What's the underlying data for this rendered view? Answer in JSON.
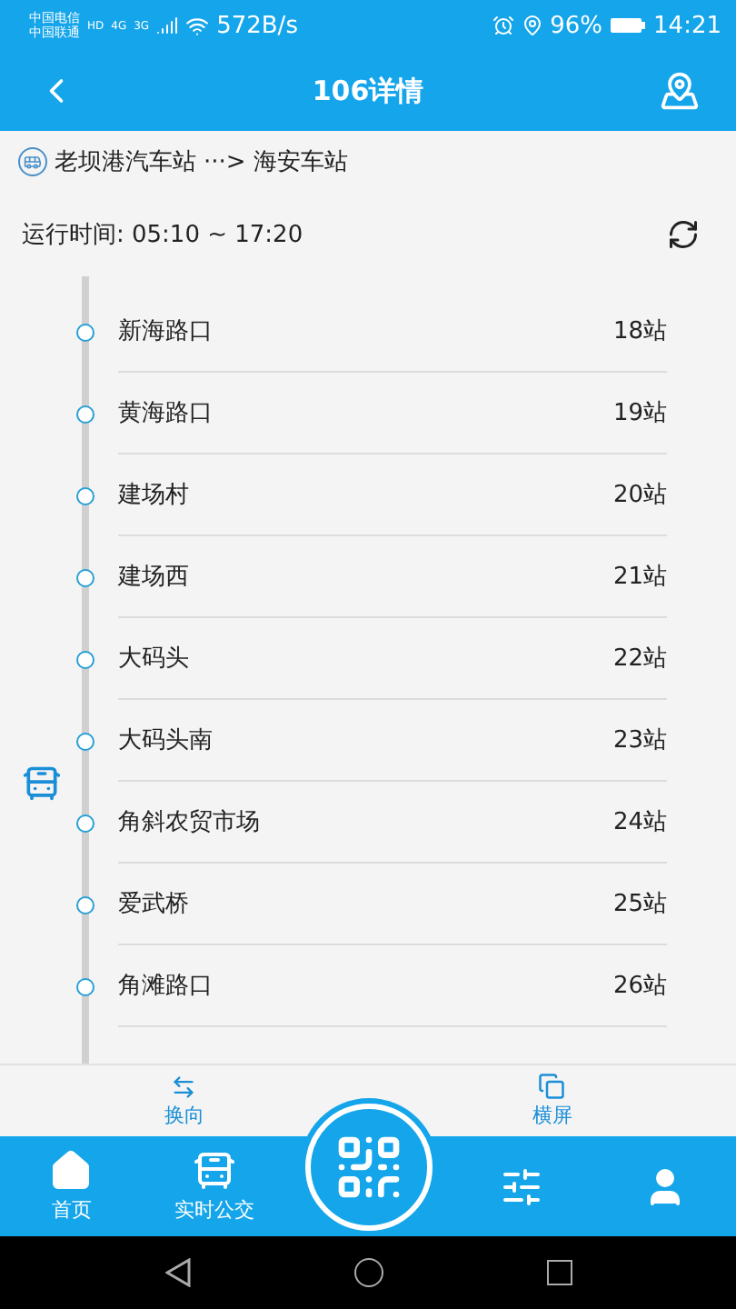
{
  "status_bar": {
    "carriers": [
      "中国电信",
      "中国联通"
    ],
    "badges": [
      "HD",
      "4G",
      "3G"
    ],
    "speed": "572B/s",
    "battery": "96%",
    "time": "14:21"
  },
  "header": {
    "title": "106详情"
  },
  "route": {
    "from": "老坝港汽车站",
    "arrow": "···>",
    "to": "海安车站"
  },
  "hours": "运行时间: 05:10 ~ 17:20",
  "stops": [
    {
      "name": "新海路口",
      "index": "18站",
      "bus_approaching": false
    },
    {
      "name": "黄海路口",
      "index": "19站",
      "bus_approaching": false
    },
    {
      "name": "建场村",
      "index": "20站",
      "bus_approaching": false
    },
    {
      "name": "建场西",
      "index": "21站",
      "bus_approaching": false
    },
    {
      "name": "大码头",
      "index": "22站",
      "bus_approaching": false
    },
    {
      "name": "大码头南",
      "index": "23站",
      "bus_approaching": false
    },
    {
      "name": "角斜农贸市场",
      "index": "24站",
      "bus_approaching": true
    },
    {
      "name": "爱武桥",
      "index": "25站",
      "bus_approaching": false
    },
    {
      "name": "角滩路口",
      "index": "26站",
      "bus_approaching": false
    }
  ],
  "actions": [
    {
      "label": "换向",
      "kind": "swap"
    },
    {
      "label": "横屏",
      "kind": "rotate"
    }
  ],
  "tabs": [
    {
      "label": "首页",
      "kind": "home"
    },
    {
      "label": "实时公交",
      "kind": "bus"
    },
    {
      "kind": "qr"
    },
    {
      "kind": "sliders"
    },
    {
      "kind": "user"
    }
  ]
}
